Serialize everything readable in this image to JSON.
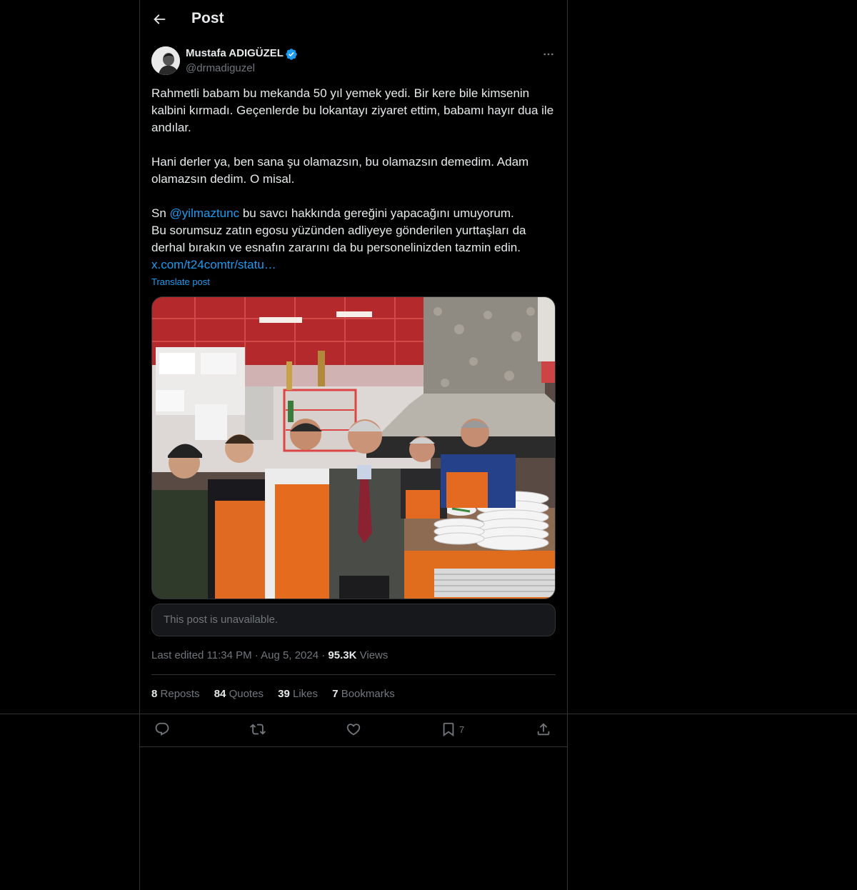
{
  "header": {
    "title": "Post"
  },
  "author": {
    "display_name": "Mustafa ADIGÜZEL",
    "handle": "@drmadiguzel",
    "verified": true
  },
  "tweet": {
    "paragraph1": "Rahmetli babam bu mekanda 50 yıl yemek yedi. Bir kere bile kimsenin kalbini kırmadı. Geçenlerde bu lokantayı ziyaret ettim, babamı hayır dua ile andılar.",
    "paragraph2": "Hani derler ya, ben sana şu olamazsın, bu olamazsın demedim. Adam olamazsın dedim. O misal.",
    "p3_prefix": "Sn ",
    "p3_mention": "@yilmaztunc",
    "p3_suffix": " bu savcı hakkında gereğini yapacağını umuyorum.",
    "paragraph4": "Bu sorumsuz zatın egosu yüzünden adliyeye gönderilen yurttaşları da derhal bırakın ve esnafın zararını da bu personelinizden tazmin edin.",
    "link": "x.com/t24comtr/statu…",
    "translate_label": "Translate post"
  },
  "quoted": {
    "unavailable_text": "This post is unavailable."
  },
  "meta": {
    "edited_label": "Last edited 11:34 PM",
    "date": "Aug 5, 2024",
    "views_count": "95.3K",
    "views_label": "Views"
  },
  "stats": {
    "reposts_count": "8",
    "reposts_label": "Reposts",
    "quotes_count": "84",
    "quotes_label": "Quotes",
    "likes_count": "39",
    "likes_label": "Likes",
    "bookmarks_count": "7",
    "bookmarks_label": "Bookmarks"
  },
  "actions": {
    "bookmark_count": "7"
  },
  "colors": {
    "accent": "#1d9bf0",
    "border": "#2f3336",
    "muted": "#71767b",
    "text": "#e7e9ea"
  }
}
